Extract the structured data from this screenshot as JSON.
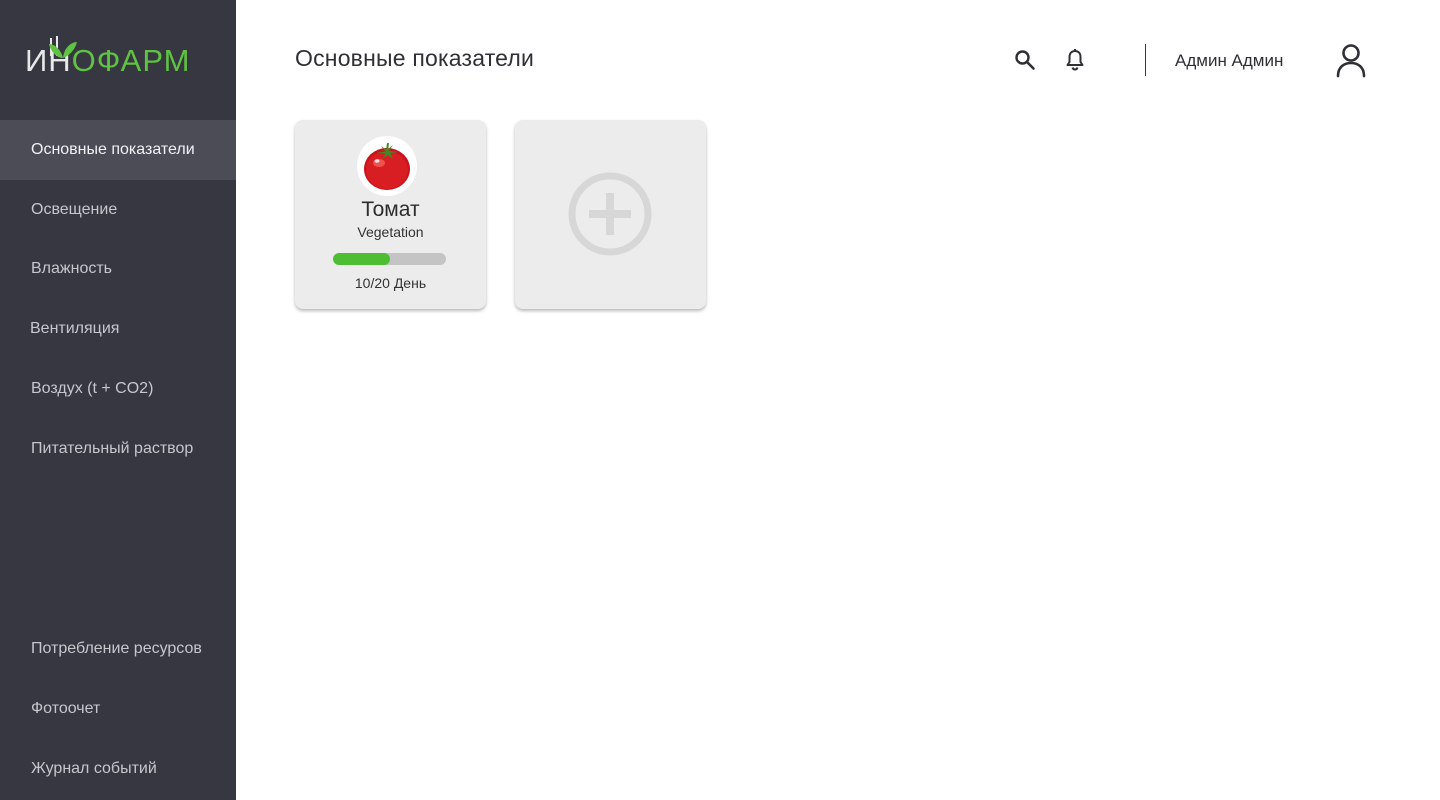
{
  "brand": {
    "logo_part1": "ИН",
    "logo_part2": "ОФАРМ",
    "leaf_color": "#5fc242"
  },
  "sidebar": {
    "items": [
      {
        "label": "Основные показатели",
        "active": true
      },
      {
        "label": "Освещение",
        "active": false
      },
      {
        "label": "Влажность",
        "active": false
      },
      {
        "label": "Вентиляция",
        "active": false
      },
      {
        "label": "Воздух (t + CO2)",
        "active": false
      },
      {
        "label": "Питательный раствор",
        "active": false
      },
      {
        "label": "Потребление ресурсов",
        "active": false
      },
      {
        "label": "Фотоочет",
        "active": false
      },
      {
        "label": "Журнал событий",
        "active": false
      }
    ]
  },
  "header": {
    "title": "Основные показатели",
    "search_icon": "search-icon",
    "bell_icon": "bell-icon",
    "user_name": "Админ Админ",
    "avatar_icon": "user-icon"
  },
  "cards": {
    "plant": {
      "name": "Томат",
      "stage": "Vegetation",
      "day_label": "10/20 День",
      "progress_fraction": 0.5,
      "image_icon": "tomato-icon"
    },
    "add": {
      "icon": "add-circle-icon"
    }
  },
  "colors": {
    "sidebar_bg": "#363740",
    "active_item_bg": "#4b4c56",
    "progress_fill": "#4dbd33",
    "card_bg": "#ececec"
  }
}
